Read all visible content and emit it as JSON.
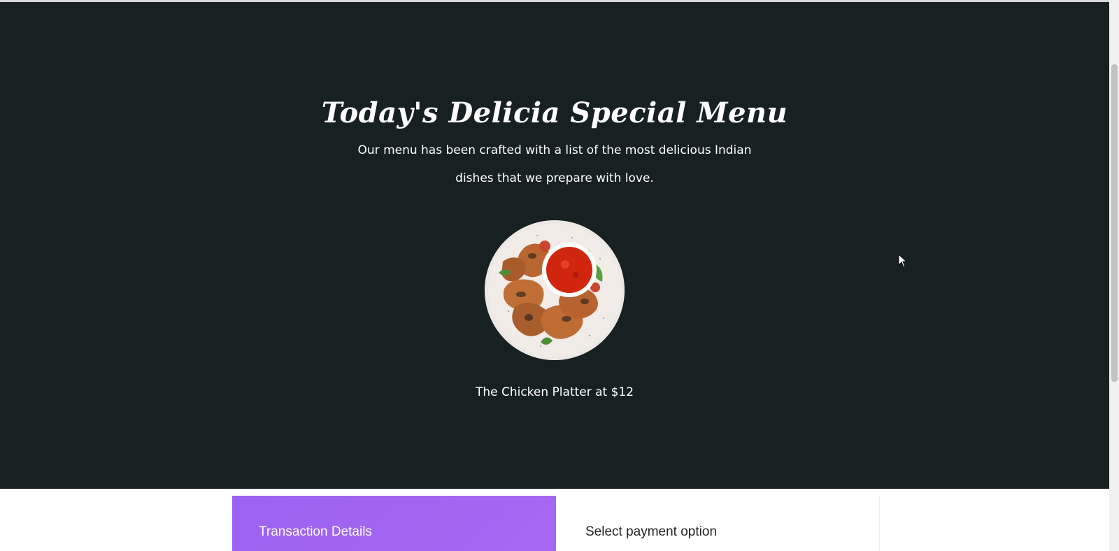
{
  "hero": {
    "title": "Today's Delicia Special Menu",
    "description": "Our menu has been crafted with a list of the most delicious Indian dishes that we prepare with love.",
    "background_color": "#172121"
  },
  "dish": {
    "caption": "The Chicken Platter at $12",
    "image_icon": "chicken-platter-image"
  },
  "transaction": {
    "title": "Transaction Details",
    "accent_color": "#a566f1"
  },
  "payment": {
    "title": "Select payment option"
  }
}
